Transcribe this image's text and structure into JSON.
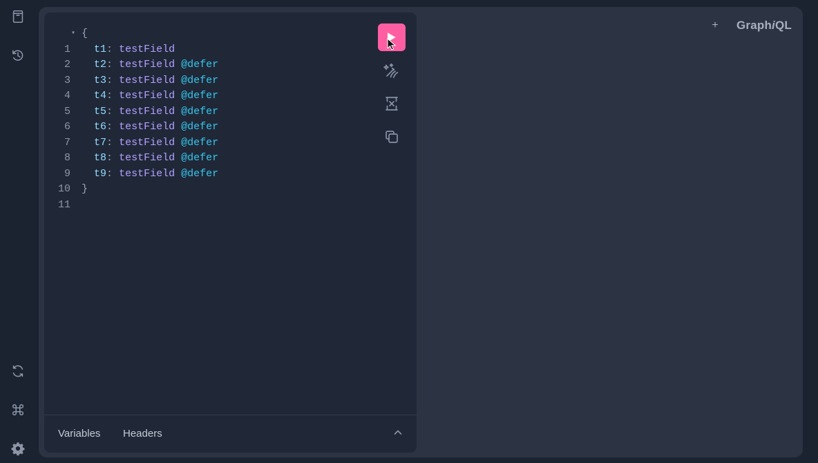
{
  "sidebar": {
    "top_buttons": [
      {
        "icon": "docs-icon"
      },
      {
        "icon": "history-icon"
      }
    ],
    "bottom_buttons": [
      {
        "icon": "refresh-icon"
      },
      {
        "icon": "command-icon"
      },
      {
        "icon": "settings-icon"
      }
    ]
  },
  "header": {
    "add_tab_symbol": "+",
    "logo": {
      "before": "Graph",
      "italic": "i",
      "after": "QL"
    }
  },
  "editor": {
    "lines": [
      {
        "number": "1",
        "fold": "▾",
        "open_brace": "{"
      },
      {
        "number": "2",
        "alias": "t1",
        "colon": ":",
        "field": "testField",
        "directive": ""
      },
      {
        "number": "3",
        "alias": "t2",
        "colon": ":",
        "field": "testField",
        "directive": "@defer"
      },
      {
        "number": "4",
        "alias": "t3",
        "colon": ":",
        "field": "testField",
        "directive": "@defer"
      },
      {
        "number": "5",
        "alias": "t4",
        "colon": ":",
        "field": "testField",
        "directive": "@defer"
      },
      {
        "number": "6",
        "alias": "t5",
        "colon": ":",
        "field": "testField",
        "directive": "@defer"
      },
      {
        "number": "7",
        "alias": "t6",
        "colon": ":",
        "field": "testField",
        "directive": "@defer"
      },
      {
        "number": "8",
        "alias": "t7",
        "colon": ":",
        "field": "testField",
        "directive": "@defer"
      },
      {
        "number": "9",
        "alias": "t8",
        "colon": ":",
        "field": "testField",
        "directive": "@defer"
      },
      {
        "number": "10",
        "alias": "t9",
        "colon": ":",
        "field": "testField",
        "directive": "@defer"
      },
      {
        "number": "11",
        "close_brace": "}"
      }
    ]
  },
  "toolbar": {
    "buttons": [
      {
        "name": "run-button",
        "icon": "play-icon"
      },
      {
        "name": "prettify-button",
        "icon": "magic-wand-icon"
      },
      {
        "name": "merge-fragments-button",
        "icon": "merge-icon"
      },
      {
        "name": "copy-query-button",
        "icon": "copy-icon"
      }
    ]
  },
  "bottom_tabs": {
    "variables": "Variables",
    "headers": "Headers"
  },
  "colors": {
    "accent": "#ff5fa2",
    "background": "#1b2230",
    "panel": "#202838",
    "alias": "#93ddff",
    "field": "#b5a0ff",
    "directive": "#36c7ed"
  }
}
